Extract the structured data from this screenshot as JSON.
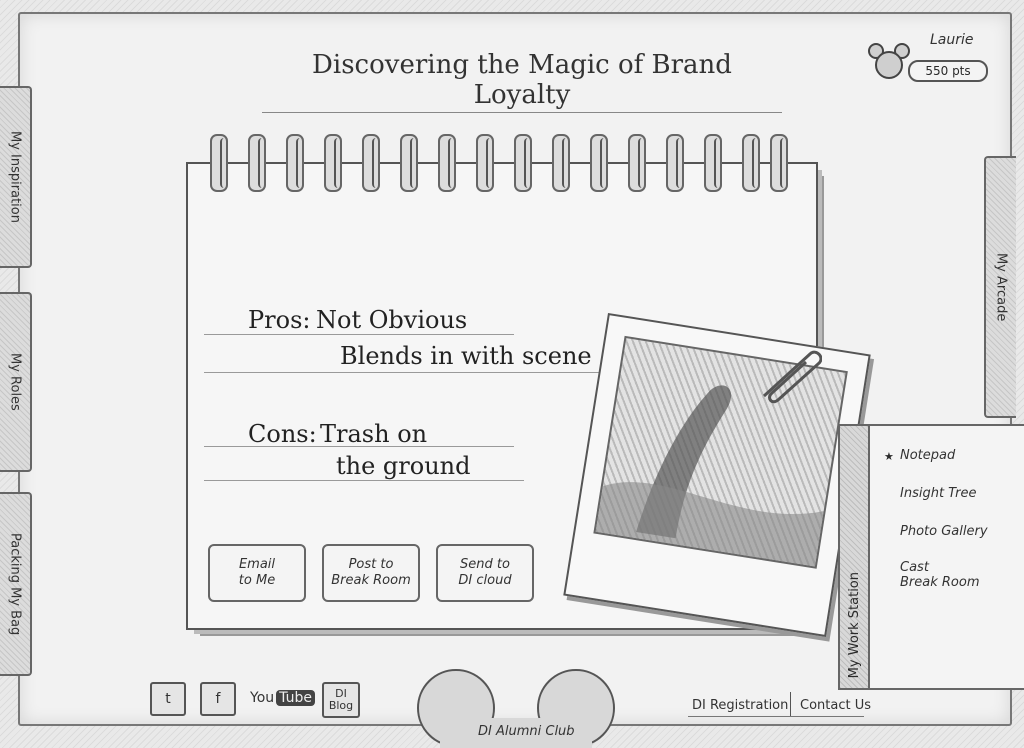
{
  "header": {
    "title": "Discovering the Magic of Brand Loyalty"
  },
  "user": {
    "name": "Laurie",
    "points": "550 pts"
  },
  "left_tabs": [
    {
      "label": "My Inspiration"
    },
    {
      "label": "My Roles"
    },
    {
      "label": "Packing My Bag"
    }
  ],
  "right_tab": {
    "label": "My Arcade"
  },
  "notebook": {
    "pros_label": "Pros:",
    "pros_line1": "Not Obvious",
    "pros_line2": "Blends in with scene",
    "cons_label": "Cons:",
    "cons_line1": "Trash on",
    "cons_line2": "the ground",
    "buttons": [
      {
        "line1": "Email",
        "line2": "to Me"
      },
      {
        "line1": "Post to",
        "line2": "Break Room"
      },
      {
        "line1": "Send to",
        "line2": "DI cloud"
      }
    ]
  },
  "workstation": {
    "tab_label": "My Work Station",
    "items": [
      {
        "label": "Notepad",
        "selected": true
      },
      {
        "label": "Insight Tree",
        "selected": false
      },
      {
        "label": "Photo Gallery",
        "selected": false
      },
      {
        "label_line1": "Cast",
        "label_line2": "Break Room",
        "selected": false
      }
    ]
  },
  "footer": {
    "social": [
      {
        "icon": "twitter-icon",
        "text": "t"
      },
      {
        "icon": "facebook-icon",
        "text": "f"
      },
      {
        "icon": "youtube-icon",
        "text_you": "You",
        "text_tube": "Tube"
      },
      {
        "icon": "di-blog-icon",
        "line1": "DI",
        "line2": "Blog"
      }
    ],
    "center_label": "DI Alumni Club",
    "links": [
      {
        "label": "DI Registration"
      },
      {
        "label": "Contact Us"
      }
    ]
  }
}
